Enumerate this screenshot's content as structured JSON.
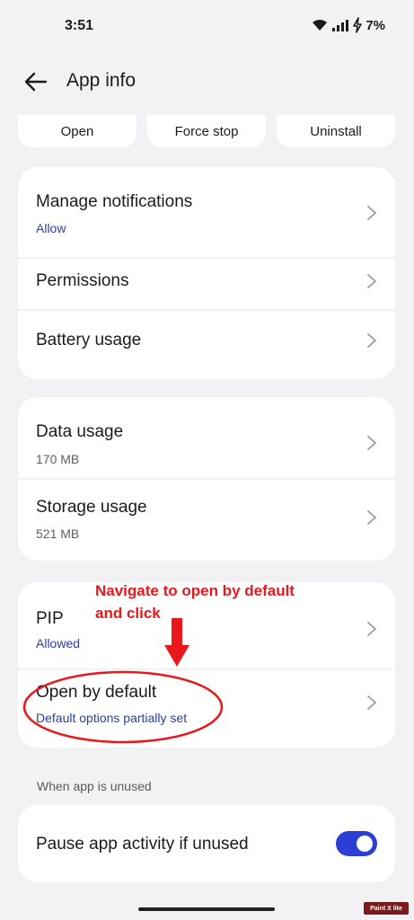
{
  "status_bar": {
    "time": "3:51",
    "battery": "7%"
  },
  "app_bar": {
    "title": "App info"
  },
  "actions": {
    "open": "Open",
    "force_stop": "Force stop",
    "uninstall": "Uninstall"
  },
  "card1": {
    "manage_notifications": {
      "title": "Manage notifications",
      "sub": "Allow"
    },
    "permissions": {
      "title": "Permissions"
    },
    "battery_usage": {
      "title": "Battery usage"
    }
  },
  "card2": {
    "data_usage": {
      "title": "Data usage",
      "sub": "170 MB"
    },
    "storage_usage": {
      "title": "Storage usage",
      "sub": "521 MB"
    }
  },
  "card3": {
    "pip": {
      "title": "PIP",
      "sub": "Allowed"
    },
    "open_by_default": {
      "title": "Open by default",
      "sub": "Default options partially set"
    }
  },
  "section": {
    "when_unused": "When app is unused"
  },
  "card4": {
    "pause_activity": {
      "title": "Pause app activity if unused",
      "toggle_on": true
    }
  },
  "annotation": {
    "line1": "Navigate to open by default",
    "line2": "and click"
  },
  "watermark": "Paint X lite",
  "colors": {
    "accent": "#2b3fd4",
    "link": "#2b3f9f",
    "annotation": "#e8181c",
    "background": "#f2f2f4",
    "card": "#ffffff"
  },
  "icons": [
    "wifi-icon",
    "signal-icon",
    "charging-bolt-icon",
    "back-arrow-icon",
    "chevron-right-icon",
    "toggle-switch",
    "red-arrow-icon",
    "red-ellipse-highlight"
  ]
}
